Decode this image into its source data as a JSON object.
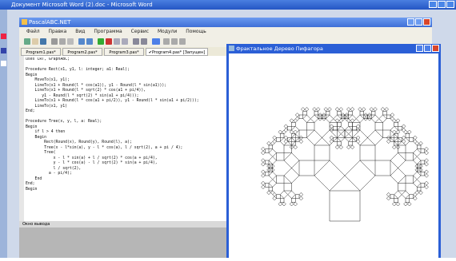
{
  "word": {
    "title": "Документ Microsoft Word (2).doc - Microsoft Word"
  },
  "pascal": {
    "title": "PascalABC.NET",
    "menu": [
      "Файл",
      "Правка",
      "Вид",
      "Программа",
      "Сервис",
      "Модули",
      "Помощь"
    ],
    "tabs": [
      "Program1.pas*",
      "Program2.pas*",
      "Program3.pas*",
      "✔Program4.pas* [Запущен]"
    ],
    "active_tab": 3,
    "output_label": "Окно вывода",
    "code_lines": [
      "uses CRT, GraphABC;",
      "",
      "Procedure Rect(x1, y1, l: integer; a1: Real);",
      "Begin",
      "    MoveTo(x1, y1);",
      "    LineTo(x1 + Round(l * cos(a1)), y1 - Round(l * sin(a1)));",
      "    LineTo(x1 + Round(l * sqrt(2) * cos(a1 + pi/4)),",
      "       y1 - Round(l * sqrt(2) * sin(a1 + pi/4)));",
      "    LineTo(x1 + Round(l * cos(a1 + pi/2)), y1 - Round(l * sin(a1 + pi/2)));",
      "    LineTo(x1, y1)",
      "End;",
      "",
      "Procedure Tree(x, y, l, a: Real);",
      "Begin",
      "    if l > 4 then",
      "    Begin",
      "        Rect(Round(x), Round(y), Round(l), a);",
      "        Tree(x - l*sin(a), y - l * cos(a), l / sqrt(2), a + pi / 4);",
      "        Tree(",
      "            x - l * sin(a) + l / sqrt(2) * cos(a + pi/4),",
      "            y - l * cos(a) - l / sqrt(2) * sin(a + pi/4),",
      "            l / sqrt(2),",
      "          a - pi/4);",
      "    End",
      "End;",
      "Begin"
    ]
  },
  "fractal_window": {
    "title": "Фрактальное Дерево Пифагора"
  }
}
